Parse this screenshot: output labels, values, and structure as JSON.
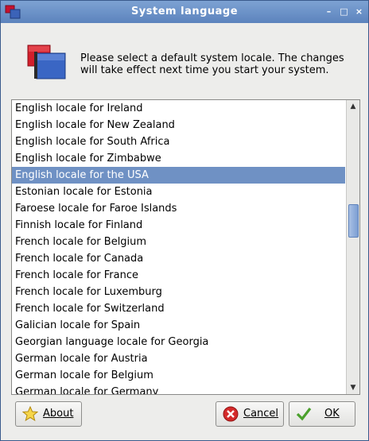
{
  "window": {
    "title": "System language"
  },
  "header": {
    "message_line1": "Please select a default system locale. The changes",
    "message_line2": "will take effect next time you start your system."
  },
  "list": {
    "selected_index": 4,
    "items": [
      "English locale for Ireland",
      "English locale for New Zealand",
      "English locale for South Africa",
      "English locale for Zimbabwe",
      "English locale for the USA",
      "Estonian locale for Estonia",
      "Faroese locale for Faroe Islands",
      "Finnish locale for Finland",
      "French locale for Belgium",
      "French locale for Canada",
      "French locale for France",
      "French locale for Luxemburg",
      "French locale for Switzerland",
      "Galician locale for Spain",
      "Georgian language locale for Georgia",
      "German locale for Austria",
      "German locale for Belgium",
      "German locale for Germany"
    ]
  },
  "buttons": {
    "about": "About",
    "cancel": "Cancel",
    "ok": "OK"
  },
  "colors": {
    "titlebar": "#6a8fc8",
    "selection": "#6f91c4"
  }
}
